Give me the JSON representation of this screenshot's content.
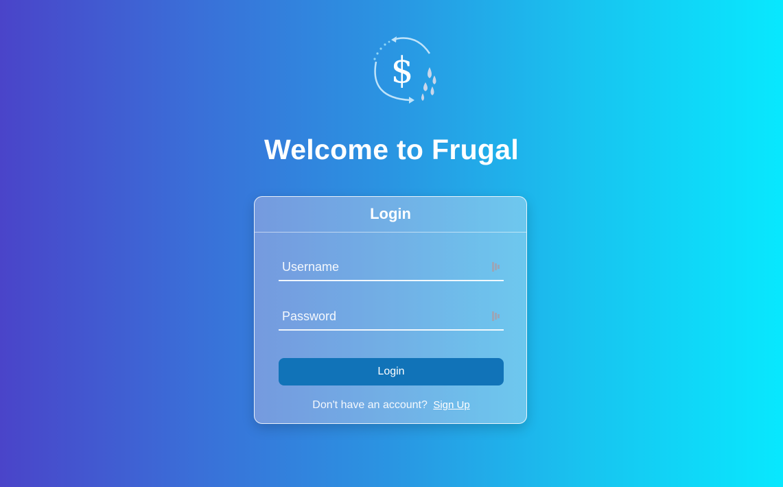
{
  "app": {
    "title": "Welcome to Frugal",
    "logo_icon": "dollar-cycle-logo-icon"
  },
  "login_card": {
    "header": "Login",
    "username": {
      "placeholder": "Username",
      "value": "",
      "icon": "password-manager-icon"
    },
    "password": {
      "placeholder": "Password",
      "value": "",
      "icon": "password-manager-icon"
    },
    "submit_label": "Login",
    "signup_prompt": "Don't have an account?",
    "signup_link": "Sign Up"
  },
  "colors": {
    "gradient_start": "#4a44c9",
    "gradient_end": "#08e8fe",
    "button": "#1173b8",
    "text": "#ffffff"
  }
}
